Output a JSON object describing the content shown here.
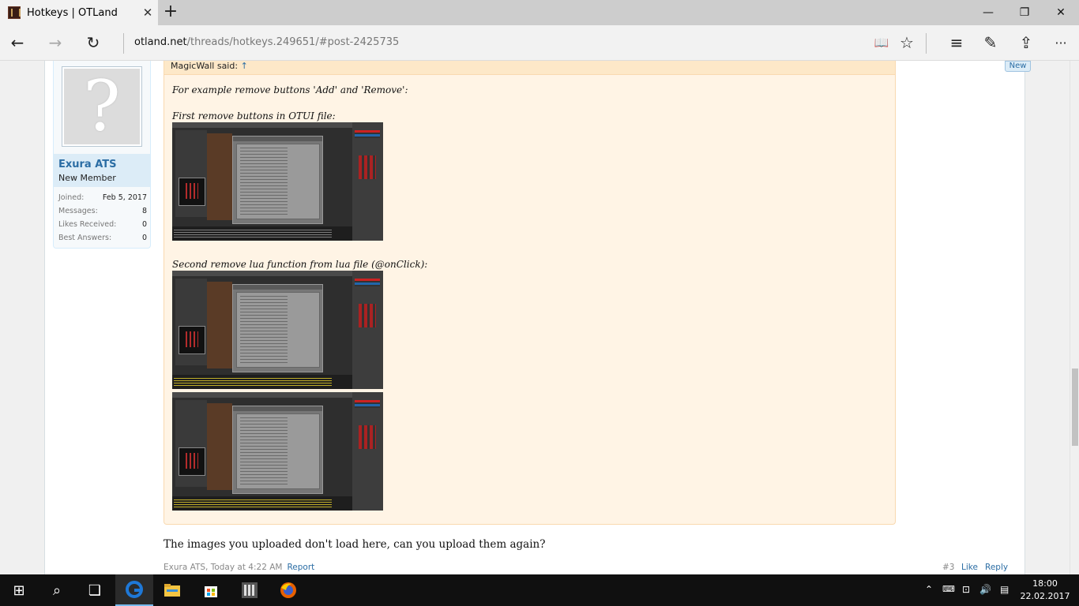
{
  "browser": {
    "tab_title": "Hotkeys | OTLand",
    "tab_close": "✕",
    "new_tab": "+",
    "url_host": "otland.net",
    "url_path": "/threads/hotkeys.249651/#post-2425735",
    "minimize": "—",
    "restore": "❐",
    "close": "✕"
  },
  "user": {
    "name": "Exura ATS",
    "title": "New Member",
    "avatar_glyph": "?",
    "stats": [
      {
        "label": "Joined:",
        "value": "Feb 5, 2017"
      },
      {
        "label": "Messages:",
        "value": "8"
      },
      {
        "label": "Likes Received:",
        "value": "0"
      },
      {
        "label": "Best Answers:",
        "value": "0"
      }
    ]
  },
  "quote": {
    "author": "MagicWall said:",
    "arrow": "↑",
    "line1": "For example remove buttons 'Add' and 'Remove':",
    "line2": "First remove buttons in OTUI file:",
    "line3": "Second remove lua function from lua file (@onClick):"
  },
  "post": {
    "text": "The images you uploaded don't load here, can you upload them again?",
    "meta": "Exura ATS, Today at 4:22 AM",
    "report": "Report",
    "number": "#3",
    "like": "Like",
    "reply": "Reply",
    "new_badge": "New"
  },
  "taskbar": {
    "time": "18:00",
    "date": "22.02.2017"
  },
  "icons": {
    "back": "←",
    "forward": "→",
    "refresh": "↻",
    "reading": "📖",
    "favorite": "☆",
    "hub": "≡",
    "note": "✎",
    "share": "⇪",
    "more": "···",
    "start": "⊞",
    "search": "⌕",
    "taskview": "❏",
    "tray_up": "⌃",
    "network": "⊡",
    "volume": "🔊",
    "notifications": "▤"
  },
  "colors": {
    "link": "#2b6da4",
    "quote_bg": "#fff4e5",
    "quote_head": "#fde8c8",
    "user_name_bg": "#dcecf7",
    "taskbar": "#101010",
    "edge_blue": "#1e78d7"
  }
}
